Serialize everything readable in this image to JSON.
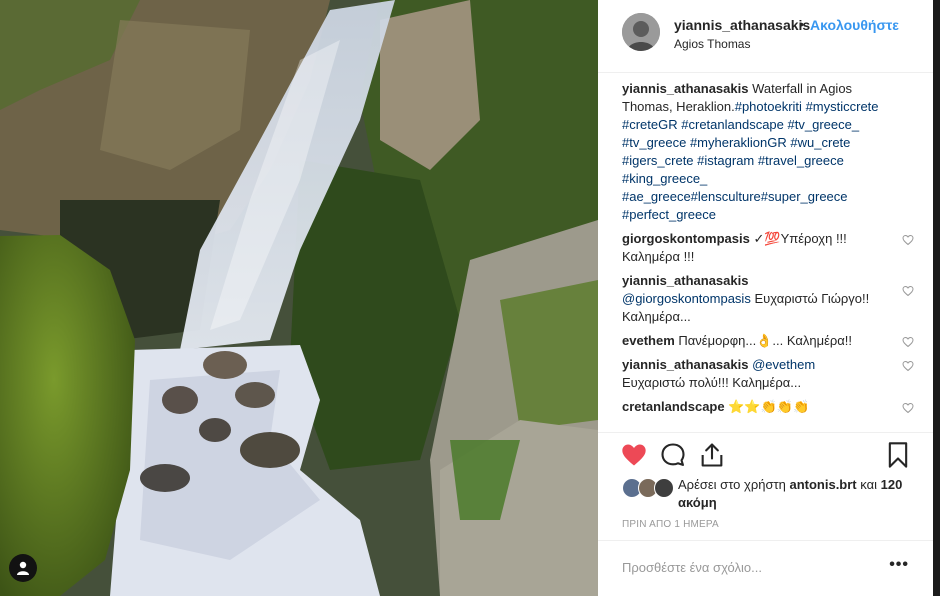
{
  "post": {
    "username": "yiannis_athanasakis",
    "separator": "•",
    "follow_label": "Ακολουθήστε",
    "location": "Agios Thomas"
  },
  "caption": {
    "username": "yiannis_athanasakis",
    "text_lead": "Waterfall in Agios Thomas, Heraklion.",
    "hashtags": [
      "#photoekriti",
      "#mysticcrete",
      "#creteGR",
      "#cretanlandscape",
      "#tv_greece_",
      "#tv_greece",
      "#myheraklionGR",
      "#wu_crete",
      "#igers_crete",
      "#istagram",
      "#travel_greece",
      "#king_greece_",
      "#ae_greece",
      "#lensculture",
      "#super_greece",
      "#perfect_greece"
    ]
  },
  "comments": [
    {
      "username": "giorgoskontompasis",
      "text": "✓💯Υπέροχη !!! Καλημέρα !!!"
    },
    {
      "username": "yiannis_athanasakis",
      "mention": "@giorgoskontompasis",
      "text": "Ευχαριστώ Γιώργο!! Καλημέρα..."
    },
    {
      "username": "evethem",
      "text": "Πανέμορφη...👌... Καλημέρα!!"
    },
    {
      "username": "yiannis_athanasakis",
      "mention": "@evethem",
      "text": "Ευχαριστώ πολύ!!! Καλημέρα..."
    },
    {
      "username": "cretanlandscape",
      "text": "⭐⭐👏👏👏"
    }
  ],
  "likes": {
    "prefix": "Αρέσει στο χρήστη",
    "user": "antonis.brt",
    "middle": "και",
    "others": "120 ακόμη"
  },
  "timestamp": "ΠΡΙΝ ΑΠΟ 1 ΗΜΕΡΑ",
  "add_comment": {
    "placeholder": "Προσθέστε ένα σχόλιο...",
    "more": "•••"
  },
  "icons": {
    "like": "heart-filled-icon",
    "comment": "comment-icon",
    "share": "share-icon",
    "save": "bookmark-icon",
    "tag": "user-tag-icon",
    "comment_like": "heart-outline-icon"
  },
  "colors": {
    "liked": "#ed4956",
    "link": "#003569",
    "follow": "#3897f0"
  }
}
